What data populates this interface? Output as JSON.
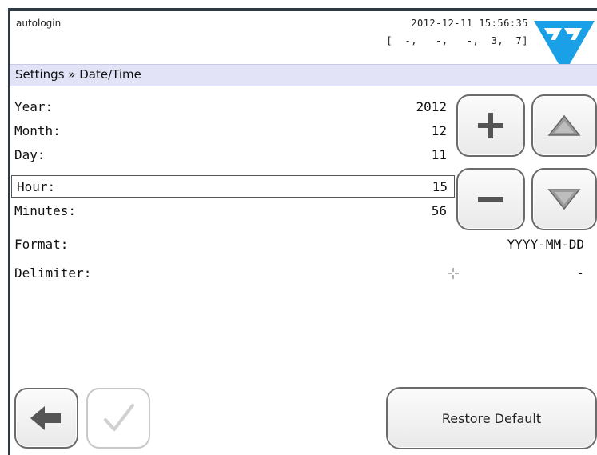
{
  "status": {
    "user": "autologin",
    "datetime": "2012-12-11 15:56:35",
    "flags": "[  -,   -,   -,  3,  7]"
  },
  "breadcrumb": "Settings » Date/Time",
  "fields": {
    "year": {
      "label": "Year:",
      "value": "2012"
    },
    "month": {
      "label": "Month:",
      "value": "12"
    },
    "day": {
      "label": "Day:",
      "value": "11"
    },
    "hour": {
      "label": "Hour:",
      "value": "15"
    },
    "minutes": {
      "label": "Minutes:",
      "value": "56"
    },
    "format": {
      "label": "Format:",
      "value": "YYYY-MM-DD"
    },
    "delimiter": {
      "label": "Delimiter:",
      "value": "-"
    }
  },
  "buttons": {
    "restore_label": "Restore Default"
  },
  "icons": {
    "plus": "plus-icon",
    "minus": "minus-icon",
    "up": "triangle-up-icon",
    "down": "triangle-down-icon",
    "back": "arrow-left-icon",
    "check": "check-icon",
    "logo": "brand-logo",
    "crosshair": "cursor-crosshair-icon"
  },
  "colors": {
    "logo_blue": "#1aa0e6",
    "breadcrumb_bg": "#e2e3f7",
    "button_border": "#6b6b6b",
    "disabled_border": "#c8c8c8"
  }
}
